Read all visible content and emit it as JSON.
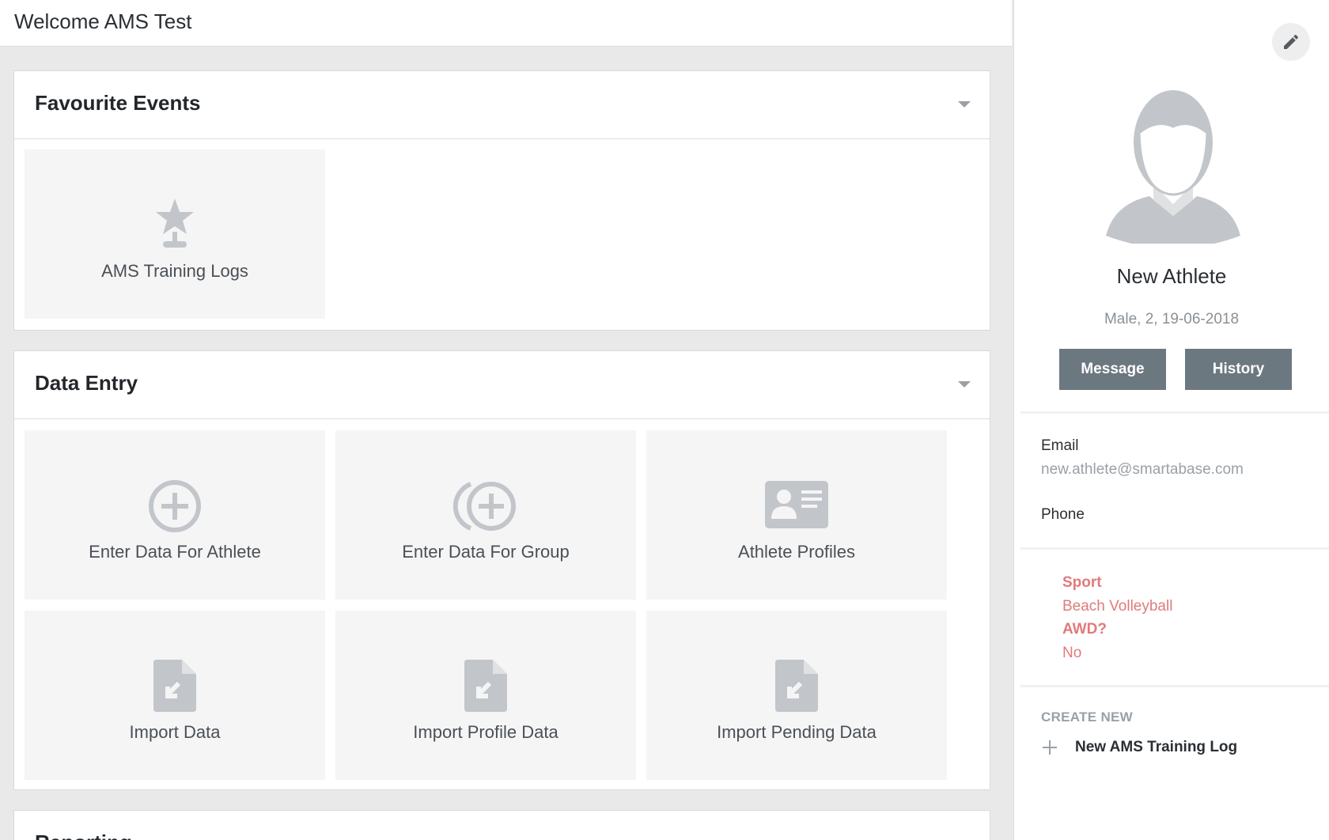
{
  "header": {
    "welcome": "Welcome AMS Test"
  },
  "favourites": {
    "title": "Favourite Events",
    "tiles": [
      {
        "label": "AMS Training Logs",
        "icon": "star-trophy-icon"
      }
    ]
  },
  "data_entry": {
    "title": "Data Entry",
    "tiles": [
      {
        "label": "Enter Data For Athlete",
        "icon": "add-circle-icon"
      },
      {
        "label": "Enter Data For Group",
        "icon": "add-group-icon"
      },
      {
        "label": "Athlete Profiles",
        "icon": "id-card-icon"
      },
      {
        "label": "Import Data",
        "icon": "file-import-icon"
      },
      {
        "label": "Import Profile Data",
        "icon": "file-import-icon"
      },
      {
        "label": "Import Pending Data",
        "icon": "file-import-icon"
      }
    ]
  },
  "reporting": {
    "title": "Reporting"
  },
  "athlete": {
    "name": "New Athlete",
    "meta": "Male, 2, 19-06-2018",
    "message_label": "Message",
    "history_label": "History",
    "email_label": "Email",
    "email": "new.athlete@smartabase.com",
    "phone_label": "Phone",
    "sport_label": "Sport",
    "sport_value": "Beach Volleyball",
    "awd_label": "AWD?",
    "awd_value": "No"
  },
  "create_new": {
    "title": "CREATE NEW",
    "item": "New AMS Training Log"
  },
  "colors": {
    "tile_bg": "#f5f5f5",
    "button": "#6c7880",
    "accent_red": "#e07b7b",
    "icon_gray": "#c2c6ca"
  }
}
